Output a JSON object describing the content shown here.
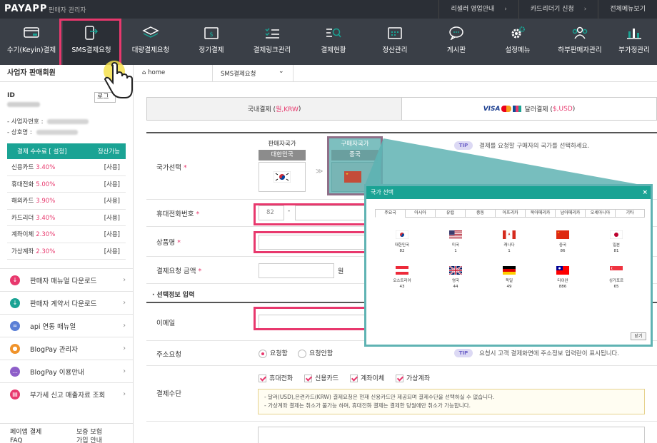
{
  "topbar": {
    "logo": "PAYAPP",
    "subtitle": "판매자 관리자",
    "links": [
      "리셀러 영업안내",
      "카드리더기 신청",
      "전체메뉴보기"
    ]
  },
  "nav": {
    "items": [
      {
        "label": "수기(Keyin)결제",
        "icon": "card-icon"
      },
      {
        "label": "SMS결제요청",
        "icon": "phone-transfer-icon"
      },
      {
        "label": "대량결제요청",
        "icon": "layers-icon"
      },
      {
        "label": "정기결제",
        "icon": "calendar-dollar-icon"
      },
      {
        "label": "결제링크관리",
        "icon": "checklist-icon"
      },
      {
        "label": "결제현황",
        "icon": "search-list-icon"
      },
      {
        "label": "정산관리",
        "icon": "calendar-grid-icon"
      },
      {
        "label": "게시판",
        "icon": "chat-icon"
      },
      {
        "label": "설정메뉴",
        "icon": "gear-icon"
      },
      {
        "label": "하부판매자관리",
        "icon": "users-icon"
      },
      {
        "label": "부가정관리",
        "icon": "bar-chart-icon"
      }
    ]
  },
  "sidebar": {
    "title": "사업자 판매회원",
    "id_label": "ID",
    "logout_label": "로그",
    "biz_no_label": "- 사업자번호 :",
    "company_label": "- 상호명 :",
    "fee_header": [
      "결제 수수료 [ 설정]",
      "정산가능"
    ],
    "fees": [
      {
        "name": "신용카드",
        "rate": "3.40%",
        "status": "[사용]"
      },
      {
        "name": "휴대전화",
        "rate": "5.00%",
        "status": "[사용]"
      },
      {
        "name": "해외카드",
        "rate": "3.90%",
        "status": "[사용]"
      },
      {
        "name": "카드리더",
        "rate": "3.40%",
        "status": "[사용]"
      },
      {
        "name": "계좌이체",
        "rate": "2.30%",
        "status": "[사용]"
      },
      {
        "name": "가상계좌",
        "rate": "2.30%",
        "status": "[사용]"
      }
    ],
    "menu": [
      {
        "label": "판매자 매뉴얼 다운로드",
        "icon": "download-icon",
        "color": "#e8386d"
      },
      {
        "label": "판매자 계약서 다운로드",
        "icon": "download-icon",
        "color": "#1aa394"
      },
      {
        "label": "api 연동 매뉴얼",
        "icon": "link-icon",
        "color": "#5b7fd6"
      },
      {
        "label": "BlogPay 관리자",
        "icon": "user-icon",
        "color": "#f0932b"
      },
      {
        "label": "BlogPay 이용안내",
        "icon": "chat-icon",
        "color": "#8e5fc9"
      },
      {
        "label": "부가세 신고 매출자료 조회",
        "icon": "book-icon",
        "color": "#e8386d"
      }
    ],
    "footer": [
      "페이앱 결제",
      "FAQ",
      "보증 보험",
      "가입 안내"
    ]
  },
  "breadcrumb": {
    "home": "home",
    "current": "SMS결제요청"
  },
  "paytabs": {
    "domestic": "국내결제 (원,KRW)",
    "domestic_plain": "국내결제 (",
    "domestic_accent": "원,KRW",
    "domestic_end": ")",
    "foreign_brands": "VISA",
    "foreign_plain": "달러결제 (",
    "foreign_accent": "$,USD",
    "foreign_end": ")"
  },
  "form": {
    "country_label": "국가선택",
    "seller_country_label": "판매자국가",
    "seller_country": "대한민국",
    "buyer_country_label": "구매자국가",
    "buyer_country": "중국",
    "country_tip": "결제를 요청할 구매자의 국가를 선택하세요.",
    "phone_label": "휴대전화번호",
    "phone_code": "82",
    "phone_dash": "-",
    "product_label": "상품명",
    "amount_label": "결제요청 금액",
    "amount_unit": "원",
    "optional_section": "· 선택정보 입력",
    "email_label": "이메일",
    "address_label": "주소요청",
    "address_yes": "요청함",
    "address_no": "요청안함",
    "address_tip": "요청시 고객 결제화면에 주소정보 입력란이 표시됩니다.",
    "tip": "TIP",
    "method_label": "결제수단",
    "methods": [
      "휴대전화",
      "신용카드",
      "계좌이체",
      "가상계좌"
    ],
    "notice": [
      "- 달러(USD),은련카드(KRW) 결제요청은 현재 신용카드만 제공되며 결제수단을 선택하실 수 없습니다.",
      "- 가상계좌 결제는 취소가 불가능 하며, 휴대전화 결제는 결제한 당월에만 취소가 가능합니다."
    ],
    "req_mark": "*"
  },
  "modal": {
    "title": "국가 선택",
    "close_x": "×",
    "regions": [
      "주요국",
      "아시아",
      "유럽",
      "중동",
      "아프리카",
      "북아메리카",
      "남아메리카",
      "오세아니아",
      "기타"
    ],
    "countries": [
      {
        "name": "대한민국",
        "code": "82",
        "flag": "kr-flag-icon"
      },
      {
        "name": "미국",
        "code": "1",
        "flag": "us-flag-icon"
      },
      {
        "name": "캐나다",
        "code": "1",
        "flag": "ca-flag-icon"
      },
      {
        "name": "중국",
        "code": "86",
        "flag": "cn-flag-icon"
      },
      {
        "name": "일본",
        "code": "81",
        "flag": "jp-flag-icon"
      },
      {
        "name": "오스트리아",
        "code": "43",
        "flag": "at-flag-icon"
      },
      {
        "name": "영국",
        "code": "44",
        "flag": "gb-flag-icon"
      },
      {
        "name": "독일",
        "code": "49",
        "flag": "de-flag-icon"
      },
      {
        "name": "타이완",
        "code": "886",
        "flag": "tw-flag-icon"
      },
      {
        "name": "싱가포르",
        "code": "65",
        "flag": "sg-flag-icon"
      }
    ],
    "close_label": "닫기"
  },
  "colors": {
    "accent": "#e8386d",
    "teal": "#1aa394",
    "nav_bg": "#3a3f47",
    "topbar_bg": "#2b2f36"
  }
}
